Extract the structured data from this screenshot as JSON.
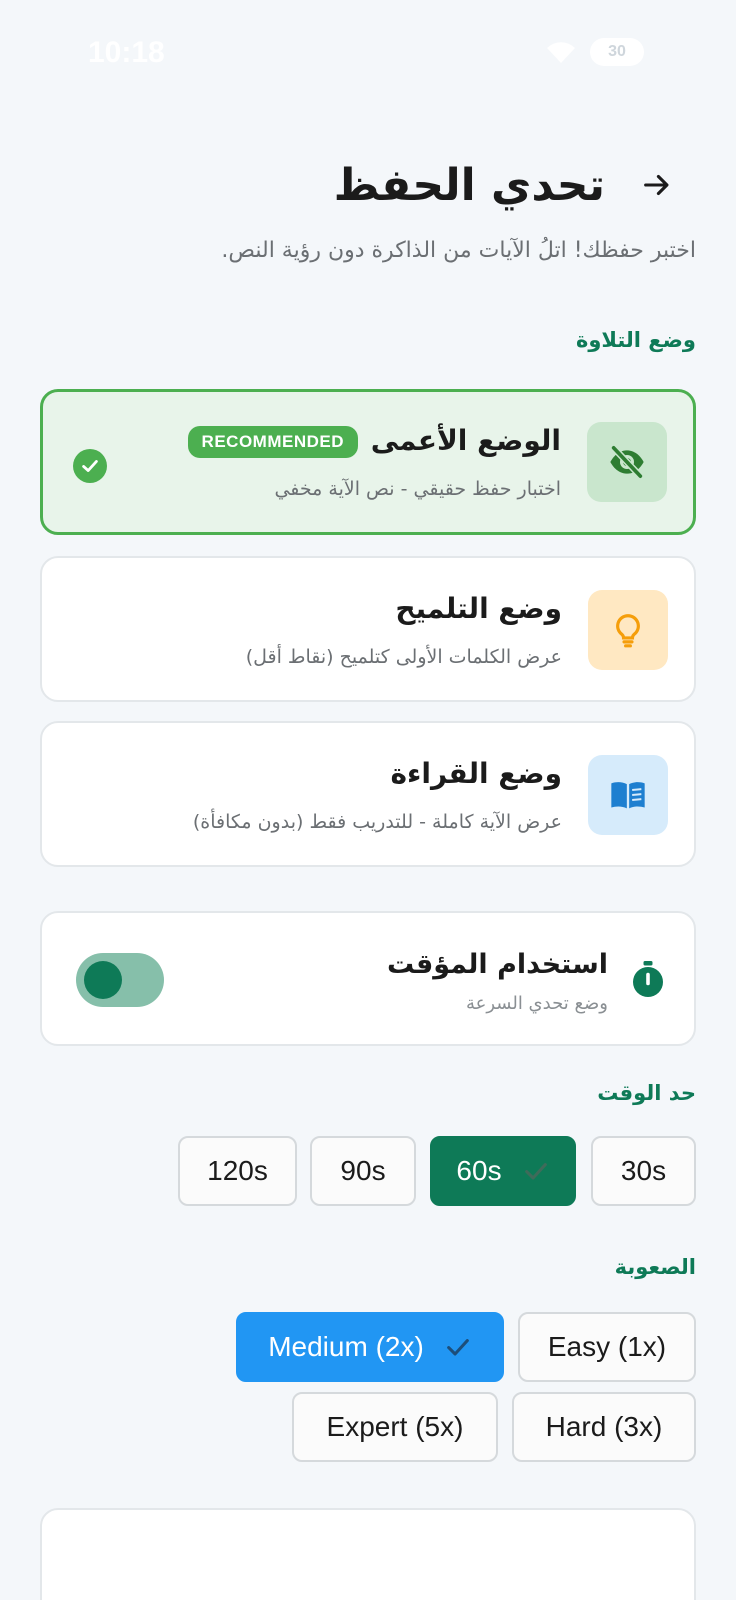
{
  "status_bar": {
    "time": "10:18",
    "battery": "30"
  },
  "header": {
    "title": "تحدي الحفظ",
    "subtitle": "اختبر حفظك! اتلُ الآيات من الذاكرة دون رؤية النص."
  },
  "recitation": {
    "section_label": "وضع التلاوة",
    "modes": [
      {
        "title": "الوضع الأعمى",
        "description": "اختبار حفظ حقيقي - نص الآية مخفي",
        "badge": "RECOMMENDED",
        "icon": "eye-off-icon",
        "selected": true,
        "icon_bg": "#C9E6CD",
        "icon_color": "#2E7D32"
      },
      {
        "title": "وضع التلميح",
        "description": "عرض الكلمات الأولى كتلميح (نقاط أقل)",
        "icon": "lightbulb-icon",
        "selected": false,
        "icon_bg": "#FFE8C2",
        "icon_color": "#F59E0B"
      },
      {
        "title": "وضع القراءة",
        "description": "عرض الآية كاملة - للتدريب فقط (بدون مكافأة)",
        "icon": "book-icon",
        "selected": false,
        "icon_bg": "#D6EBFB",
        "icon_color": "#1E7FD0"
      }
    ]
  },
  "timer": {
    "title": "استخدام المؤقت",
    "description": "وضع تحدي السرعة",
    "icon": "stopwatch-icon",
    "enabled": true
  },
  "time_limit": {
    "label": "حد الوقت",
    "options": [
      "30s",
      "60s",
      "90s",
      "120s"
    ],
    "selected": "60s"
  },
  "difficulty": {
    "label": "الصعوبة",
    "options": [
      "Easy (1x)",
      "Medium (2x)",
      "Hard (3x)",
      "Expert (5x)"
    ],
    "selected": "Medium (2x)"
  },
  "colors": {
    "primary_green": "#0E7A57",
    "selected_border": "#4CAF50",
    "selected_bg": "#E8F4EA",
    "blue": "#2196F3",
    "background": "#F4F7FA"
  }
}
